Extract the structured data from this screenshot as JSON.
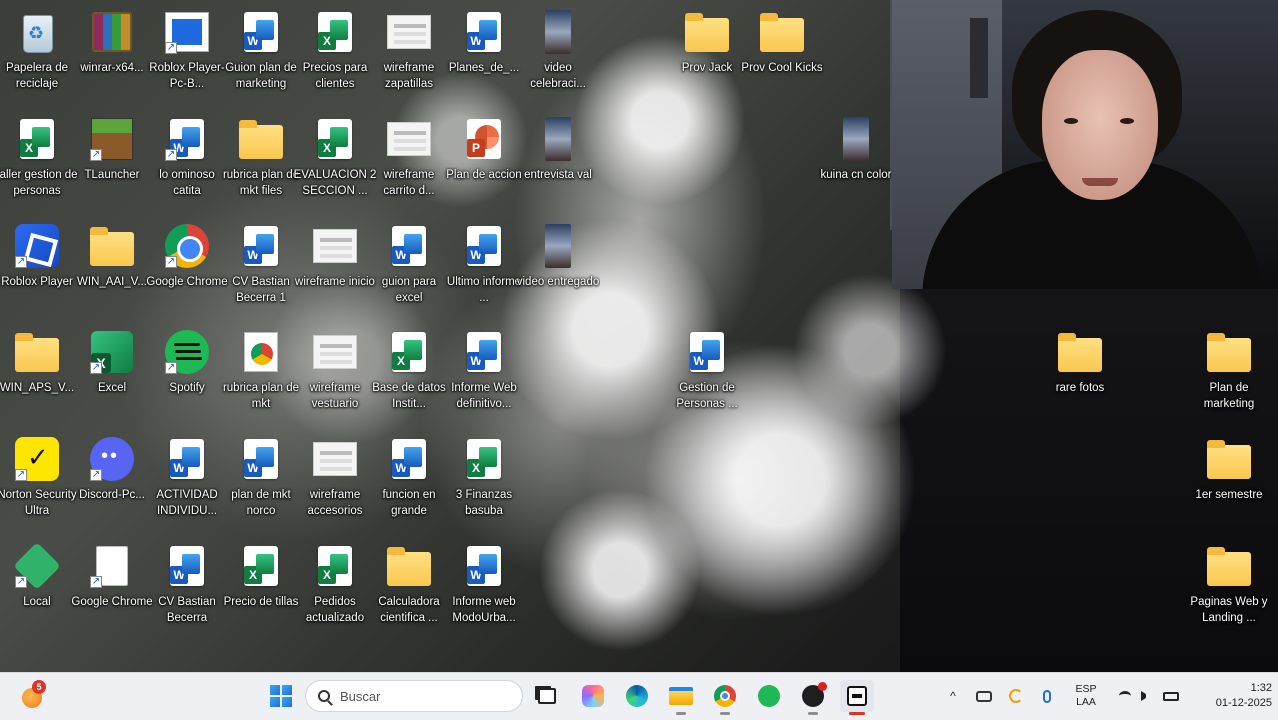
{
  "desktop_icons": [
    {
      "label": "Papelera de reciclaje",
      "icon": "recycle-bin-icon"
    },
    {
      "label": "winrar-x64...",
      "icon": "winrar-icon"
    },
    {
      "label": "Roblox Player-Pc-B...",
      "icon": "roblox-file-icon"
    },
    {
      "label": "Guion plan de marketing",
      "icon": "word-doc-icon"
    },
    {
      "label": "Precios para clientes",
      "icon": "excel-doc-icon"
    },
    {
      "label": "wireframe zapatillas",
      "icon": "wireframe-thumb-icon"
    },
    {
      "label": "Planes_de_...",
      "icon": "word-doc-icon"
    },
    {
      "label": "video celebraci...",
      "icon": "video-thumb-icon"
    },
    {
      "label": "Prov Jack",
      "icon": "folder-icon"
    },
    {
      "label": "Prov Cool Kicks",
      "icon": "folder-icon"
    },
    {
      "label": "taller gestion de personas",
      "icon": "excel-doc-icon"
    },
    {
      "label": "TLauncher",
      "icon": "tlauncher-icon"
    },
    {
      "label": "lo ominoso catita",
      "icon": "word-doc-icon"
    },
    {
      "label": "rubrica plan de mkt files",
      "icon": "folder-icon"
    },
    {
      "label": "EVALUACION 2 SECCION ...",
      "icon": "excel-doc-icon"
    },
    {
      "label": "wireframe carrito d...",
      "icon": "wireframe-thumb-icon"
    },
    {
      "label": "Plan de accion",
      "icon": "powerpoint-doc-icon"
    },
    {
      "label": "entrevista val",
      "icon": "video-thumb-icon"
    },
    {
      "label": "kuina cn color",
      "icon": "video-thumb-icon"
    },
    {
      "label": "Roblox Player",
      "icon": "roblox-app-icon"
    },
    {
      "label": "WIN_AAI_V...",
      "icon": "folder-icon"
    },
    {
      "label": "Google Chrome",
      "icon": "chrome-icon"
    },
    {
      "label": "CV Bastian Becerra 1",
      "icon": "word-doc-icon"
    },
    {
      "label": "wireframe inicio",
      "icon": "wireframe-thumb-icon"
    },
    {
      "label": "guion para excel",
      "icon": "word-doc-icon"
    },
    {
      "label": "Ultimo informe ...",
      "icon": "word-doc-icon"
    },
    {
      "label": "video entregado",
      "icon": "video-thumb-icon"
    },
    {
      "label": "WIN_APS_V...",
      "icon": "folder-icon"
    },
    {
      "label": "Excel",
      "icon": "excel-app-icon"
    },
    {
      "label": "Spotify",
      "icon": "spotify-icon"
    },
    {
      "label": "rubrica plan de mkt",
      "icon": "chrome-doc-icon"
    },
    {
      "label": "wireframe vestuario",
      "icon": "wireframe-thumb-icon"
    },
    {
      "label": "Base de datos Instit...",
      "icon": "excel-doc-icon"
    },
    {
      "label": "Informe Web definitivo...",
      "icon": "word-doc-icon"
    },
    {
      "label": "Gestion de Personas ...",
      "icon": "word-doc-icon"
    },
    {
      "label": "rare fotos",
      "icon": "folder-icon"
    },
    {
      "label": "Plan de marketing",
      "icon": "folder-icon"
    },
    {
      "label": "Norton Security Ultra",
      "icon": "norton-icon"
    },
    {
      "label": "Discord-Pc...",
      "icon": "discord-icon"
    },
    {
      "label": "ACTIVIDAD INDIVIDU...",
      "icon": "word-doc-icon"
    },
    {
      "label": "plan de mkt norco",
      "icon": "word-doc-icon"
    },
    {
      "label": "wireframe accesorios",
      "icon": "wireframe-thumb-icon"
    },
    {
      "label": "funcion en grande",
      "icon": "word-doc-icon"
    },
    {
      "label": "3 Finanzas basuba",
      "icon": "excel-doc-icon"
    },
    {
      "label": "1er semestre",
      "icon": "folder-icon"
    },
    {
      "label": "Local",
      "icon": "local-icon"
    },
    {
      "label": "Google Chrome",
      "icon": "blank-doc-icon"
    },
    {
      "label": "CV Bastian Becerra",
      "icon": "word-doc-icon"
    },
    {
      "label": "Precio de tillas",
      "icon": "excel-doc-icon"
    },
    {
      "label": "Pedidos actualizado",
      "icon": "excel-doc-icon"
    },
    {
      "label": "Calculadora cientifica ...",
      "icon": "folder-icon"
    },
    {
      "label": "Informe web ModoUrba...",
      "icon": "word-doc-icon"
    },
    {
      "label": "Paginas Web y Landing ...",
      "icon": "folder-icon"
    }
  ],
  "taskbar": {
    "weather_badge": "5",
    "search_placeholder": "Buscar",
    "apps": [
      "start-icon",
      "task-view-icon",
      "copilot-icon",
      "edge-icon",
      "file-explorer-icon",
      "chrome-icon",
      "spotify-icon",
      "obs-icon",
      "capcut-icon"
    ],
    "language_line1": "ESP",
    "language_line2": "LAA",
    "time": "1:32",
    "date": "01-12-2025"
  },
  "colors": {
    "taskbar_bg": "#eef0f4",
    "word": "#185abd",
    "excel": "#107c41",
    "folder": "#f9c74f"
  }
}
